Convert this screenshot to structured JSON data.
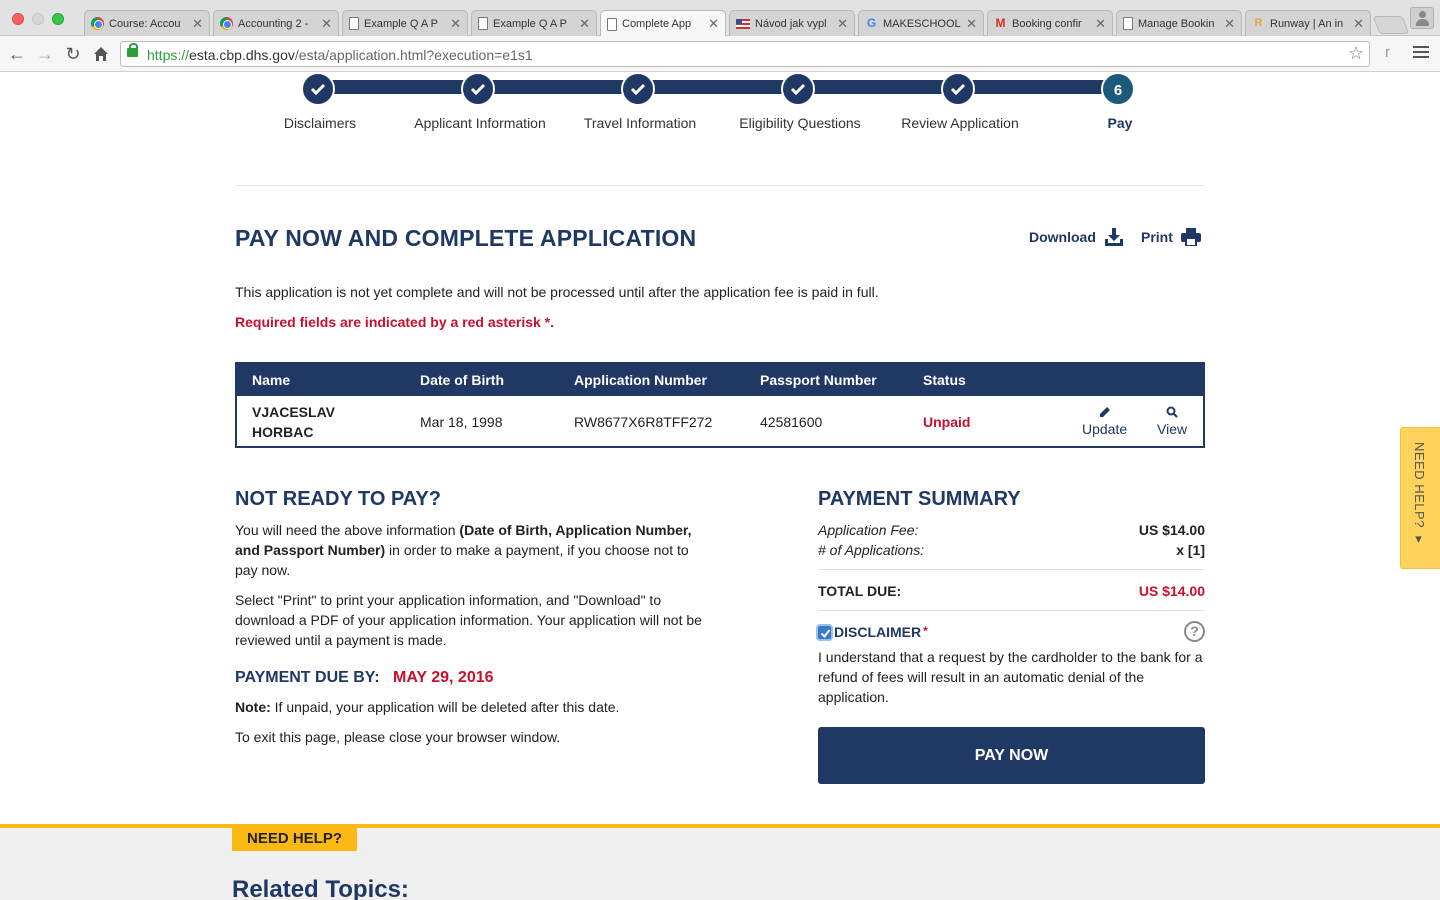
{
  "browser": {
    "tabs": [
      {
        "label": "Course: Accou",
        "icon": "chrome-icon"
      },
      {
        "label": "Accounting 2 -",
        "icon": "chrome-icon"
      },
      {
        "label": "Example Q A P",
        "icon": "document-icon"
      },
      {
        "label": "Example Q A P",
        "icon": "document-icon"
      },
      {
        "label": "Complete App",
        "icon": "document-icon"
      },
      {
        "label": "Návod jak vypl",
        "icon": "flag-icon"
      },
      {
        "label": "MAKESCHOOL",
        "icon": "google-icon"
      },
      {
        "label": "Booking confir",
        "icon": "gmail-icon"
      },
      {
        "label": "Manage Bookin",
        "icon": "document-icon"
      },
      {
        "label": "Runway | An in",
        "icon": "runway-icon"
      }
    ],
    "active_tab": 4,
    "url_scheme": "https://",
    "url_host": "esta.cbp.dhs.gov",
    "url_path": "/esta/application.html?execution=e1s1"
  },
  "steps": [
    {
      "number": "1",
      "label": "Disclaimers",
      "state": "done"
    },
    {
      "number": "2",
      "label": "Applicant Information",
      "state": "done"
    },
    {
      "number": "3",
      "label": "Travel Information",
      "state": "done"
    },
    {
      "number": "4",
      "label": "Eligibility Questions",
      "state": "done"
    },
    {
      "number": "5",
      "label": "Review Application",
      "state": "done"
    },
    {
      "number": "6",
      "label": "Pay",
      "state": "current"
    }
  ],
  "header": {
    "title": "PAY NOW AND COMPLETE APPLICATION",
    "download_label": "Download",
    "print_label": "Print"
  },
  "intro_text": "This application is not yet complete and will not be processed until after the application fee is paid in full.",
  "required_note": "Required fields are indicated by a red asterisk *.",
  "table": {
    "headers": [
      "Name",
      "Date of Birth",
      "Application Number",
      "Passport Number",
      "Status"
    ],
    "row": {
      "name_line1": "VJACESLAV",
      "name_line2": "HORBAC",
      "dob": "Mar 18, 1998",
      "application_number": "RW8677X6R8TFF272",
      "passport_number": "42581600",
      "status": "Unpaid",
      "update_label": "Update",
      "view_label": "View"
    }
  },
  "not_ready": {
    "title": "NOT READY TO PAY?",
    "p1_a": "You will need the above information ",
    "p1_b": "(Date of Birth, Application Number, and Passport Number)",
    "p1_c": " in order to make a payment, if you choose not to pay now.",
    "p2": "Select \"Print\" to print your application information, and \"Download\" to download a PDF of your application information. Your application will not be reviewed until a payment is made.",
    "due_label": "PAYMENT DUE BY:",
    "due_date": "MAY 29, 2016",
    "note_label": "Note:",
    "note_text": " If unpaid, your application will be deleted after this date.",
    "exit_text": "To exit this page, please close your browser window."
  },
  "summary": {
    "title": "PAYMENT SUMMARY",
    "fee_label": "Application Fee:",
    "fee_value": "US $14.00",
    "count_label": "# of Applications:",
    "count_value": "x [1]",
    "total_label": "TOTAL DUE:",
    "total_value": "US $14.00",
    "disclaimer_label": "DISCLAIMER",
    "disclaimer_asterisk": "*",
    "disclaimer_checked": true,
    "disclaimer_text": "I understand that a request by the cardholder to the bank for a refund of fees will result in an automatic denial of the application.",
    "help_glyph": "?",
    "pay_button": "PAY NOW"
  },
  "footer": {
    "need_help": "NEED HELP?",
    "related_topics": "Related Topics:"
  },
  "side_help": "NEED HELP? ▾",
  "colors": {
    "navy": "#1f3864",
    "red": "#c8102e",
    "gold": "#fdb913"
  }
}
